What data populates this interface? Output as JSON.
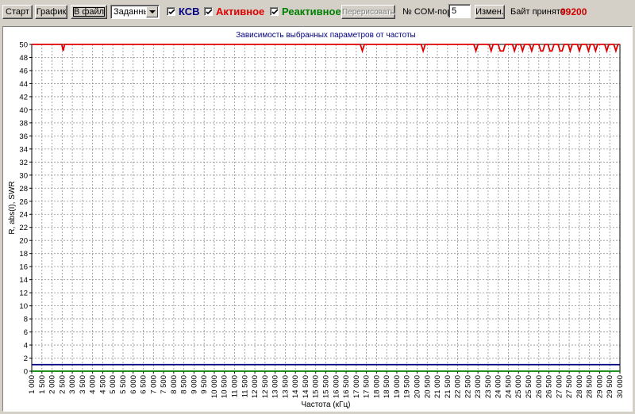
{
  "toolbar": {
    "start_label": "Старт",
    "graph_label": "График",
    "to_file_label": "В файл",
    "mode_select": {
      "selected": "Заданный"
    },
    "checkboxes": [
      {
        "label": "КСВ",
        "checked": true,
        "color": "#000080"
      },
      {
        "label": "Активное",
        "checked": true,
        "color": "#e00000"
      },
      {
        "label": "Реактивное",
        "checked": true,
        "color": "#008000"
      }
    ],
    "recalc_label": "Перерисовать",
    "com_port_label": "№ COM-порта:",
    "com_port_value": "5",
    "change_label": "Измен.",
    "bytes_label": "Байт принято:",
    "bytes_value": "99200"
  },
  "chart_data": {
    "type": "line",
    "title": "Зависимость выбранных параметров от частоты",
    "xlabel": "Частота (кГц)",
    "ylabel": "R, abs(I), SWR",
    "xlim": [
      1000,
      30000
    ],
    "ylim": [
      0,
      50
    ],
    "x_tick_step": 500,
    "y_tick_step": 2,
    "grid": true,
    "x_tick_labels": [
      "1 000",
      "1 500",
      "2 000",
      "2 500",
      "3 000",
      "3 500",
      "4 000",
      "4 500",
      "5 000",
      "5 500",
      "6 000",
      "6 500",
      "7 000",
      "7 500",
      "8 000",
      "8 500",
      "9 000",
      "9 500",
      "10 000",
      "10 500",
      "11 000",
      "11 500",
      "12 000",
      "12 500",
      "13 000",
      "13 500",
      "14 000",
      "14 500",
      "15 000",
      "15 500",
      "16 000",
      "16 500",
      "17 000",
      "17 500",
      "18 000",
      "18 500",
      "19 000",
      "19 500",
      "20 000",
      "20 500",
      "21 000",
      "21 500",
      "22 000",
      "22 500",
      "23 000",
      "23 500",
      "24 000",
      "24 500",
      "25 000",
      "25 500",
      "26 000",
      "26 500",
      "27 000",
      "27 500",
      "28 000",
      "28 500",
      "29 000",
      "29 500",
      "30 000"
    ],
    "y_tick_labels": [
      "0",
      "2",
      "4",
      "6",
      "8",
      "10",
      "12",
      "14",
      "16",
      "18",
      "20",
      "22",
      "24",
      "26",
      "28",
      "30",
      "32",
      "34",
      "36",
      "38",
      "40",
      "42",
      "44",
      "46",
      "48",
      "50"
    ],
    "series": [
      {
        "color": "#e00000",
        "points": [
          [
            1000,
            50
          ],
          [
            2480,
            50
          ],
          [
            2550,
            49
          ],
          [
            2620,
            50
          ],
          [
            17200,
            50
          ],
          [
            17300,
            49
          ],
          [
            17400,
            50
          ],
          [
            20200,
            50
          ],
          [
            20300,
            49
          ],
          [
            20400,
            50
          ],
          [
            22800,
            50
          ],
          [
            22900,
            49
          ],
          [
            23000,
            50
          ],
          [
            23550,
            50
          ],
          [
            23650,
            49
          ],
          [
            23750,
            50
          ],
          [
            24000,
            50
          ],
          [
            24100,
            49
          ],
          [
            24250,
            49
          ],
          [
            24350,
            50
          ],
          [
            24700,
            50
          ],
          [
            24800,
            49
          ],
          [
            24900,
            50
          ],
          [
            25100,
            50
          ],
          [
            25200,
            49
          ],
          [
            25300,
            50
          ],
          [
            25550,
            50
          ],
          [
            25650,
            49
          ],
          [
            25750,
            50
          ],
          [
            26000,
            50
          ],
          [
            26100,
            49
          ],
          [
            26200,
            49
          ],
          [
            26300,
            50
          ],
          [
            26450,
            50
          ],
          [
            26550,
            49
          ],
          [
            26650,
            49
          ],
          [
            26750,
            50
          ],
          [
            26950,
            50
          ],
          [
            27050,
            49
          ],
          [
            27150,
            49
          ],
          [
            27250,
            50
          ],
          [
            27450,
            50
          ],
          [
            27550,
            49
          ],
          [
            27650,
            50
          ],
          [
            27900,
            50
          ],
          [
            28000,
            49
          ],
          [
            28100,
            50
          ],
          [
            28350,
            50
          ],
          [
            28450,
            49
          ],
          [
            28550,
            50
          ],
          [
            28700,
            50
          ],
          [
            28800,
            49
          ],
          [
            28900,
            50
          ],
          [
            29250,
            50
          ],
          [
            29350,
            49
          ],
          [
            29450,
            50
          ],
          [
            29700,
            50
          ],
          [
            29800,
            49
          ],
          [
            29900,
            50
          ],
          [
            30000,
            50
          ]
        ]
      },
      {
        "color": "#000080",
        "points": [
          [
            1000,
            1
          ],
          [
            30000,
            1
          ]
        ]
      },
      {
        "color": "#008000",
        "points": [
          [
            1000,
            0
          ],
          [
            30000,
            0
          ]
        ]
      }
    ]
  }
}
